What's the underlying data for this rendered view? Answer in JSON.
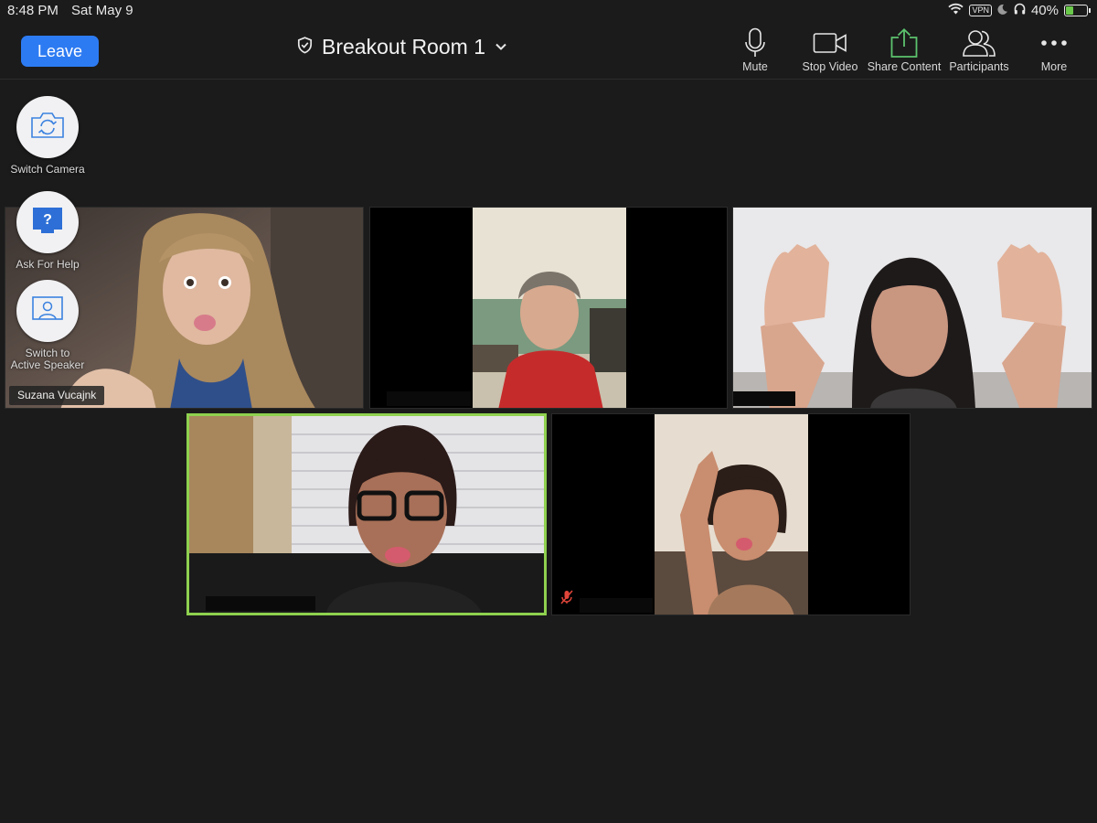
{
  "status_bar": {
    "time": "8:48 PM",
    "date": "Sat May 9",
    "vpn": "VPN",
    "battery_percent": "40%",
    "battery_level": 0.4
  },
  "toolbar": {
    "leave_label": "Leave",
    "room_title": "Breakout Room 1",
    "mute_label": "Mute",
    "stop_video_label": "Stop Video",
    "share_content_label": "Share Content",
    "participants_label": "Participants",
    "more_label": "More"
  },
  "side_buttons": {
    "switch_camera": "Switch Camera",
    "ask_for_help": "Ask For Help",
    "switch_speaker_line1": "Switch to",
    "switch_speaker_line2": "Active Speaker"
  },
  "participants": [
    {
      "name": "Suzana Vucajnk"
    }
  ],
  "colors": {
    "accent": "#2d7bf2",
    "active_speaker_border": "#8fd14f",
    "share_icon": "#5cc36e",
    "muted_icon": "#e0453a"
  }
}
